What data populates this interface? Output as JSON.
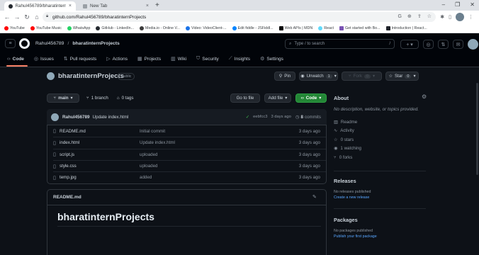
{
  "browser": {
    "tabs": [
      {
        "title": "Rahul456789/bharatinternProje...",
        "active": true
      },
      {
        "title": "New Tab",
        "active": false
      }
    ],
    "url": "github.com/Rahul456789/bharatinternProjects",
    "bookmarks": [
      "YouTube",
      "YouTube Music",
      "WhatsApp",
      "GitHub - LinkedIn...",
      "Media.io - Online V...",
      "Video: VideoClient-...",
      "Edit fiddle - JSFiddl...",
      "Web APIs | MDN",
      "React",
      "Get started with Bo...",
      "Introduction | React..."
    ]
  },
  "github": {
    "owner": "Rahul456789",
    "repo": "bharatinternProjects",
    "search_placeholder": "Type / to search",
    "search_hint": "/",
    "nav": [
      "Code",
      "Issues",
      "Pull requests",
      "Actions",
      "Projects",
      "Wiki",
      "Security",
      "Insights",
      "Settings"
    ],
    "visibility": "Public",
    "pin_label": "Pin",
    "unwatch_label": "Unwatch",
    "unwatch_count": "1",
    "fork_label": "Fork",
    "fork_count": "0",
    "star_label": "Star",
    "star_count": "0",
    "branch": "main",
    "branches": "1 branch",
    "tags": "0 tags",
    "goto_file": "Go to file",
    "add_file": "Add file",
    "code_btn": "Code",
    "commit": {
      "author": "Rahul456789",
      "message": "Update index.html",
      "hash": "eebfcc3",
      "when": "3 days ago",
      "commits": "8",
      "commits_label": "commits"
    },
    "files": [
      {
        "name": "README.md",
        "message": "Initial commit",
        "age": "3 days ago",
        "icon": "file-icon"
      },
      {
        "name": "index.html",
        "message": "Update index.html",
        "age": "3 days ago",
        "icon": "file-icon"
      },
      {
        "name": "script.js",
        "message": "uploaded",
        "age": "3 days ago",
        "icon": "file-icon"
      },
      {
        "name": "style.css",
        "message": "uploaded",
        "age": "3 days ago",
        "icon": "file-icon"
      },
      {
        "name": "temp.jpg",
        "message": "added",
        "age": "3 days ago",
        "icon": "file-icon"
      }
    ],
    "readme_title": "README.md",
    "readme_heading": "bharatinternProjects",
    "about": {
      "title": "About",
      "description": "No description, website, or topics provided.",
      "items": [
        "Readme",
        "Activity",
        "0 stars",
        "1 watching",
        "0 forks"
      ]
    },
    "releases": {
      "title": "Releases",
      "empty": "No releases published",
      "link": "Create a new release"
    },
    "packages": {
      "title": "Packages",
      "empty": "No packages published",
      "link": "Publish your first package"
    }
  },
  "colors": {
    "accent": "#f78166",
    "link": "#58a6ff",
    "green": "#238636",
    "bg": "#0d1117"
  }
}
